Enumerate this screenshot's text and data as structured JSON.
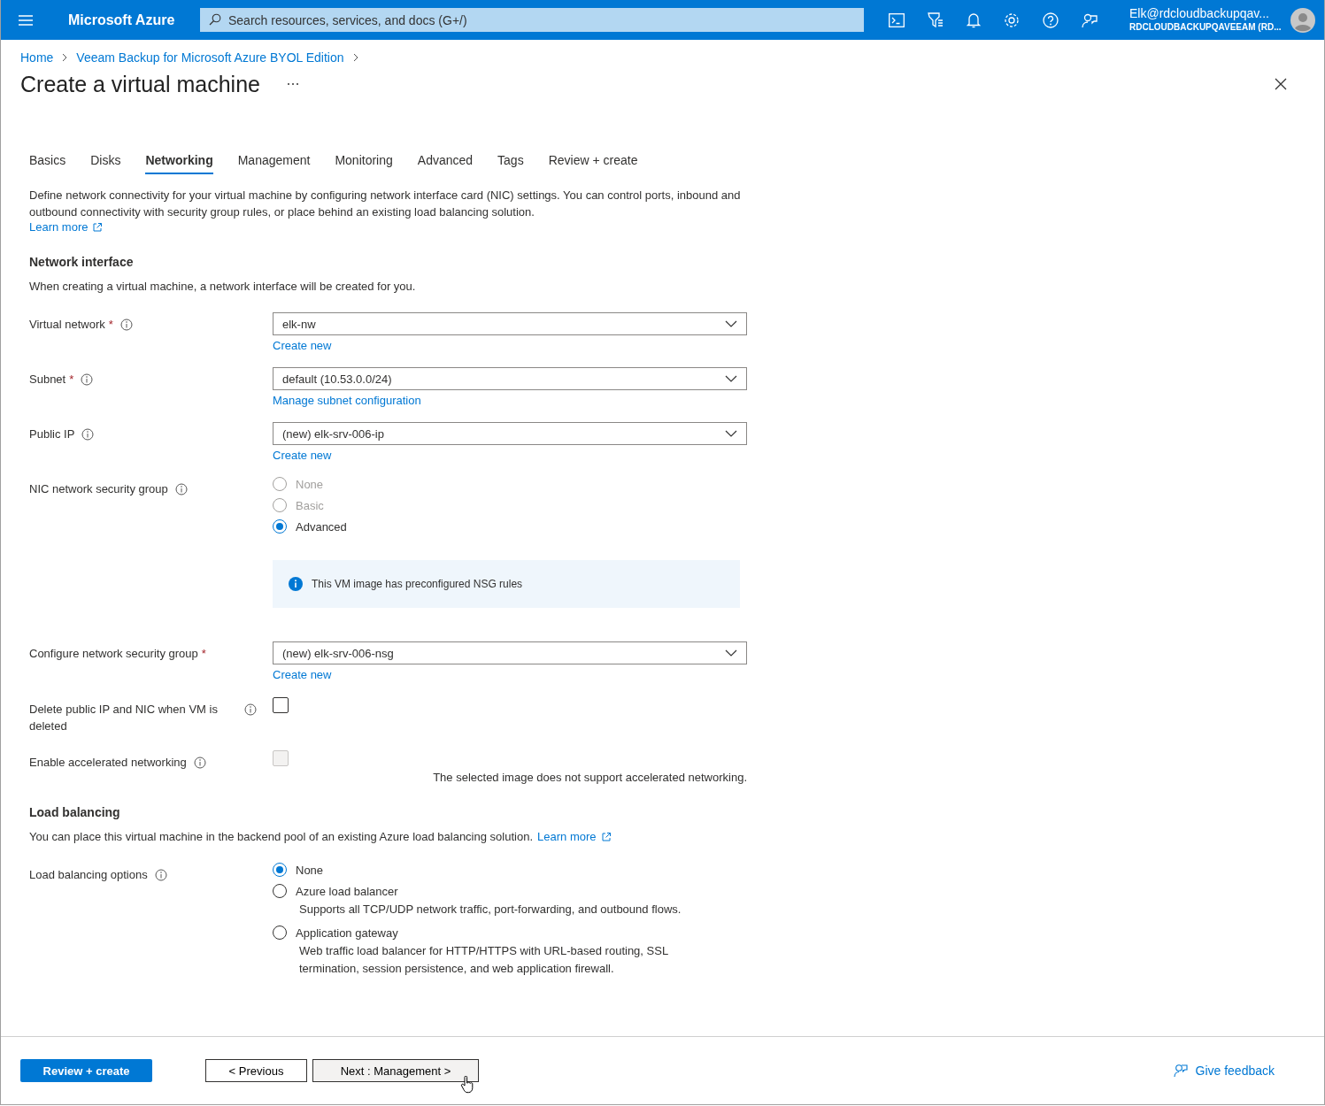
{
  "header": {
    "brand": "Microsoft Azure",
    "search": {
      "placeholder": "Search resources, services, and docs (G+/)"
    },
    "user": {
      "name": "Elk@rdcloudbackupqav...",
      "tenant": "RDCLOUDBACKUPQAVEEAM (RD..."
    }
  },
  "breadcrumb": [
    "Home",
    "Veeam Backup for Microsoft Azure BYOL Edition"
  ],
  "title": "Create a virtual machine",
  "tabs": [
    {
      "label": "Basics",
      "selected": false
    },
    {
      "label": "Disks",
      "selected": false
    },
    {
      "label": "Networking",
      "selected": true
    },
    {
      "label": "Management",
      "selected": false
    },
    {
      "label": "Monitoring",
      "selected": false
    },
    {
      "label": "Advanced",
      "selected": false
    },
    {
      "label": "Tags",
      "selected": false
    },
    {
      "label": "Review + create",
      "selected": false
    }
  ],
  "intro": {
    "text": "Define network connectivity for your virtual machine by configuring network interface card (NIC) settings. You can control ports, inbound and outbound connectivity with security group rules, or place behind an existing load balancing solution.",
    "link": "Learn more"
  },
  "sections": [
    {
      "heading": "Network interface",
      "description": "When creating a virtual machine, a network interface will be created for you.",
      "fields": [
        {
          "kind": "dropdown",
          "label": "Virtual network",
          "required_mark": "*",
          "info": true,
          "value": "elk-nw",
          "link": "Create new"
        },
        {
          "kind": "dropdown",
          "label": "Subnet",
          "required_mark": "*",
          "info": true,
          "value": "default (10.53.0.0/24)",
          "link": "Manage subnet configuration"
        },
        {
          "kind": "dropdown",
          "label": "Public IP",
          "info": true,
          "value": "(new) elk-srv-006-ip",
          "link": "Create new"
        },
        {
          "kind": "radio",
          "label": "NIC network security group",
          "info": true,
          "options": [
            {
              "label": "None",
              "selected": false,
              "disabled": true
            },
            {
              "label": "Basic",
              "selected": false,
              "disabled": true
            },
            {
              "label": "Advanced",
              "selected": true,
              "disabled": false
            }
          ],
          "notice": "This VM image has preconfigured NSG rules"
        },
        {
          "kind": "dropdown",
          "label": "Configure network security group",
          "required_mark": "*",
          "value": "(new) elk-srv-006-nsg",
          "link": "Create new"
        },
        {
          "kind": "checkbox",
          "label": "Delete public IP and NIC when VM is deleted",
          "info": true,
          "checked": false,
          "disabled": false
        },
        {
          "kind": "checkbox",
          "label": "Enable accelerated networking",
          "info": true,
          "checked": false,
          "disabled": true,
          "note": "The selected image does not support accelerated networking."
        }
      ]
    },
    {
      "heading": "Load balancing",
      "description": "You can place this virtual machine in the backend pool of an existing Azure load balancing solution.",
      "link": "Learn more",
      "fields": [
        {
          "kind": "radio",
          "label": "Load balancing options",
          "info": true,
          "options": [
            {
              "label": "None",
              "selected": true,
              "disabled": false
            },
            {
              "label": "Azure load balancer",
              "selected": false,
              "disabled": false,
              "description": "Supports all TCP/UDP network traffic, port-forwarding, and outbound flows."
            },
            {
              "label": "Application gateway",
              "selected": false,
              "disabled": false,
              "description": "Web traffic load balancer for HTTP/HTTPS with URL-based routing, SSL termination, session persistence, and web application firewall."
            }
          ]
        }
      ]
    }
  ],
  "footer": {
    "buttons": [
      {
        "label": "Review + create",
        "kind": "primary",
        "hovered": false
      },
      {
        "label": "< Previous",
        "kind": "secondary",
        "hovered": false
      },
      {
        "label": "Next : Management >",
        "kind": "secondary",
        "hovered": true
      }
    ],
    "feedback": "Give feedback"
  }
}
